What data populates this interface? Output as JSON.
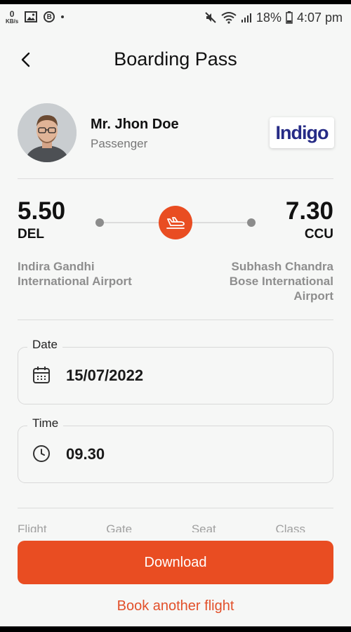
{
  "status_bar": {
    "net_speed_value": "0",
    "net_speed_unit": "KB/s",
    "battery_percent": "18%",
    "time": "4:07 pm"
  },
  "header": {
    "title": "Boarding Pass"
  },
  "passenger": {
    "name": "Mr. Jhon Doe",
    "role": "Passenger",
    "airline_logo_text": "Indigo"
  },
  "flight": {
    "departure": {
      "time": "5.50",
      "code": "DEL",
      "airport": "Indira Gandhi International Airport"
    },
    "arrival": {
      "time": "7.30",
      "code": "CCU",
      "airport": "Subhash Chandra Bose International Airport"
    }
  },
  "details": {
    "date_label": "Date",
    "date_value": "15/07/2022",
    "time_label": "Time",
    "time_value": "09.30"
  },
  "info_columns": [
    "Flight",
    "Gate",
    "Seat",
    "Class"
  ],
  "actions": {
    "download_label": "Download",
    "book_another_label": "Book another flight"
  },
  "colors": {
    "accent": "#e94d22",
    "text_muted": "#8e8e8e",
    "airline_logo": "#262b86"
  },
  "icons": {
    "back": "back-arrow-icon",
    "plane": "airplane-icon",
    "calendar": "calendar-icon",
    "clock": "clock-icon"
  }
}
